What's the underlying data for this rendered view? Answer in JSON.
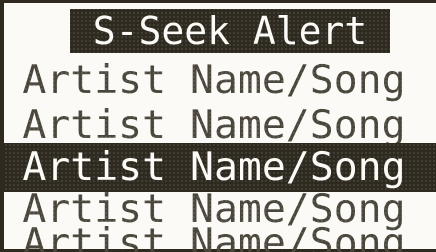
{
  "screen": {
    "title": "S-Seek Alert",
    "selected_index": 2,
    "items": [
      {
        "label": "Artist Name/Song"
      },
      {
        "label": "Artist Name/Song"
      },
      {
        "label": "Artist Name/Song"
      },
      {
        "label": "Artist Name/Song"
      },
      {
        "label": "Artist Name/Song"
      }
    ]
  },
  "colors": {
    "background": "#fbfaf6",
    "ink": "#2e2a20",
    "text": "#4a463c"
  }
}
